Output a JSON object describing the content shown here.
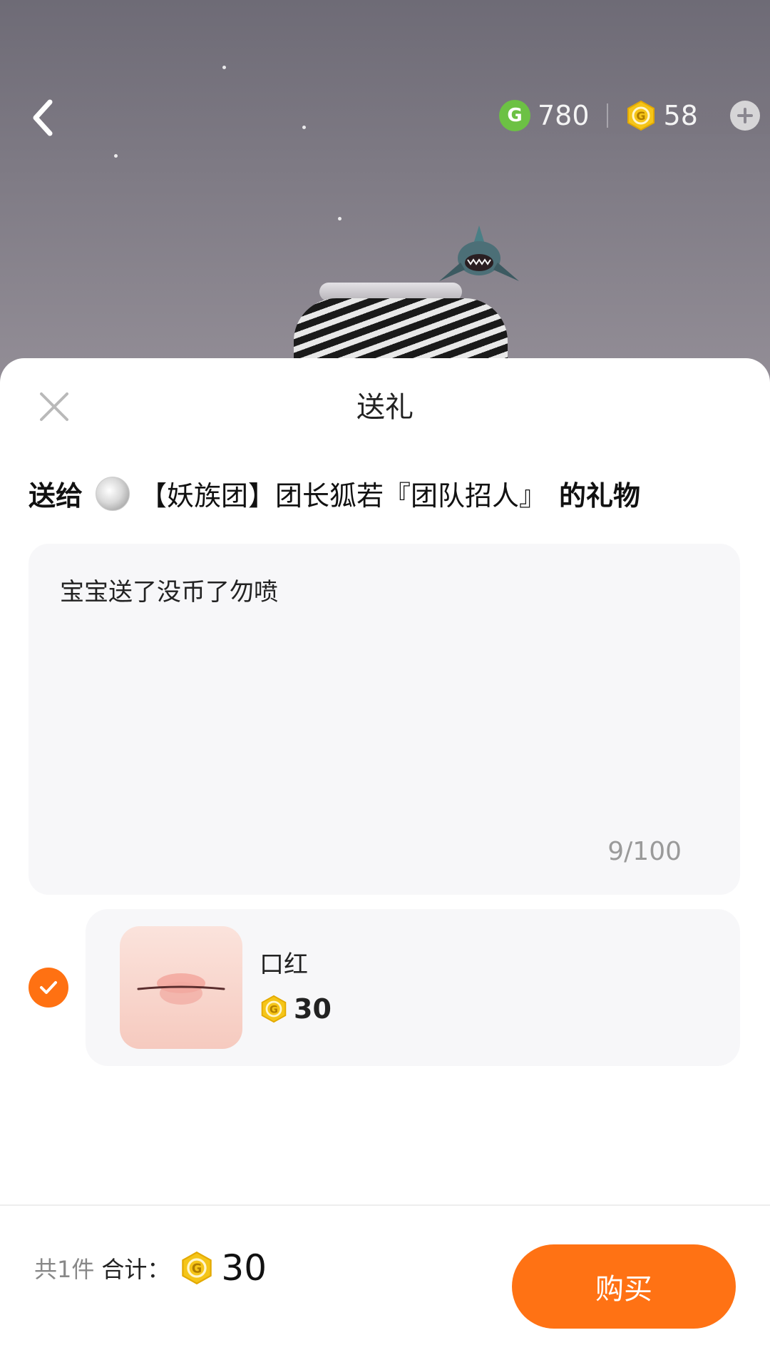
{
  "header": {
    "green_coin_balance": "780",
    "gold_coin_balance": "58"
  },
  "sheet": {
    "title": "送礼",
    "recipient_prefix": "送给",
    "recipient_name": "【妖族团】团长狐若『团队招人』",
    "recipient_suffix": "的礼物",
    "message_text": "宝宝送了没币了勿喷",
    "message_count": "9/100"
  },
  "gift": {
    "name": "口红",
    "price": "30",
    "selected": true
  },
  "footer": {
    "count_label": "共1件",
    "total_label": "合计：",
    "total_value": "30",
    "buy_label": "购买"
  },
  "colors": {
    "accent": "#ff7214",
    "coin_gold": "#f5c518",
    "coin_green": "#6cc144",
    "panel_bg": "#f7f7f9"
  }
}
